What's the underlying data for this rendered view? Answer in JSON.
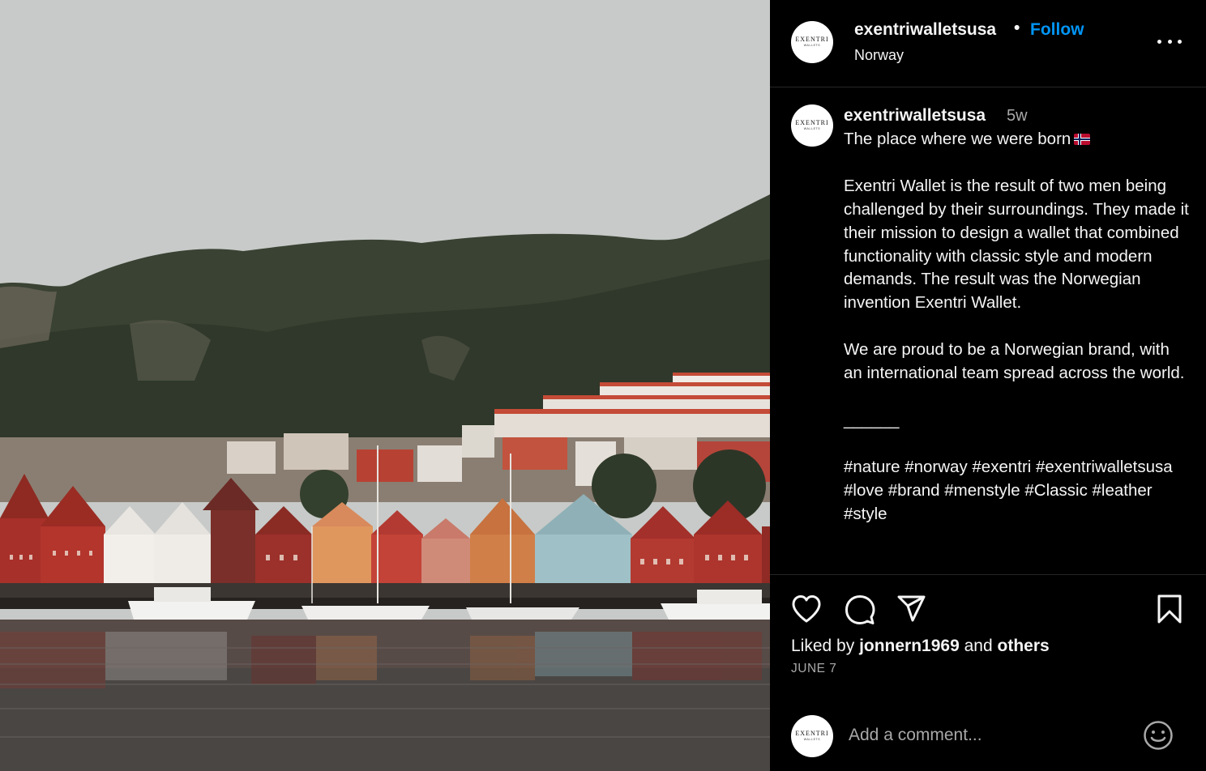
{
  "post": {
    "username": "exentriwalletsusa",
    "separator": "•",
    "follow_label": "Follow",
    "location": "Norway",
    "avatar_logo": {
      "main": "EXENTRI",
      "sub": "WALLETS"
    }
  },
  "caption": {
    "username": "exentriwalletsusa",
    "time_ago": "5w",
    "first_line": "The place where we were born",
    "flag": "norway-flag",
    "body": "Exentri Wallet is the result of two men being challenged by their surroundings. They made it their mission to design a wallet that combined functionality with classic style and modern demands. The result was the Norwegian invention Exentri Wallet.",
    "body2": "We are proud to be a Norwegian brand, with an international team spread across the world.",
    "divider": "______",
    "hashtags": "#nature #norway #exentri #exentriwalletsusa #love #brand #menstyle #Classic #leather #style"
  },
  "actions": {
    "icons": [
      "heart-icon",
      "comment-icon",
      "share-icon",
      "bookmark-icon"
    ]
  },
  "likes": {
    "prefix": "Liked by",
    "user": "jonnern1969",
    "joiner": "and",
    "others": "others"
  },
  "date": "JUNE 7",
  "comment_box": {
    "placeholder": "Add a comment...",
    "emoji_icon": "smiley-icon"
  },
  "photo": {
    "subject": "harbor-photo"
  },
  "colors": {
    "background": "#000000",
    "text": "#f5f5f5",
    "secondary_text": "#a8a8a8",
    "accent": "#0095f6",
    "divider": "#262626"
  }
}
